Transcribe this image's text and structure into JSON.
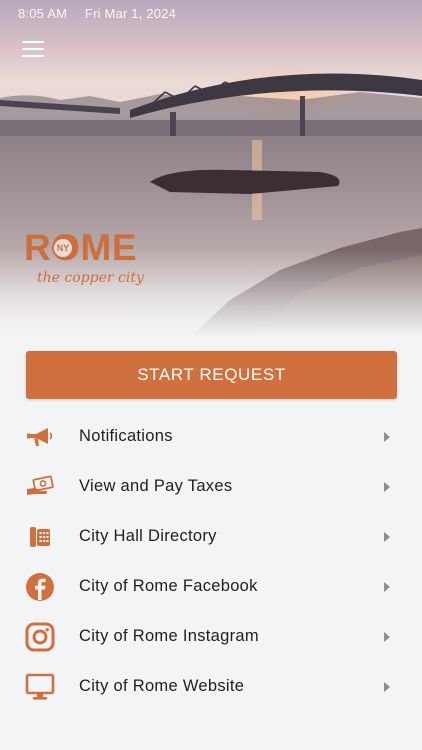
{
  "status_bar": {
    "time": "8:05 AM",
    "date": "Fri Mar 1, 2024"
  },
  "header": {
    "menu_icon": "hamburger-icon"
  },
  "logo": {
    "word": "ROME",
    "badge": "NY",
    "tagline": "the copper city"
  },
  "primary_action": {
    "label": "START REQUEST"
  },
  "menu": [
    {
      "label": "Notifications",
      "icon": "megaphone-icon"
    },
    {
      "label": "View and Pay Taxes",
      "icon": "money-hand-icon"
    },
    {
      "label": "City Hall Directory",
      "icon": "telephone-icon"
    },
    {
      "label": "City of Rome Facebook",
      "icon": "facebook-icon"
    },
    {
      "label": "City of Rome Instagram",
      "icon": "instagram-icon"
    },
    {
      "label": "City of Rome Website",
      "icon": "monitor-icon"
    }
  ],
  "colors": {
    "accent": "#d0703f",
    "background": "#f3f4f6",
    "text": "#1f1f1f",
    "chevron": "#8e8e8e"
  }
}
